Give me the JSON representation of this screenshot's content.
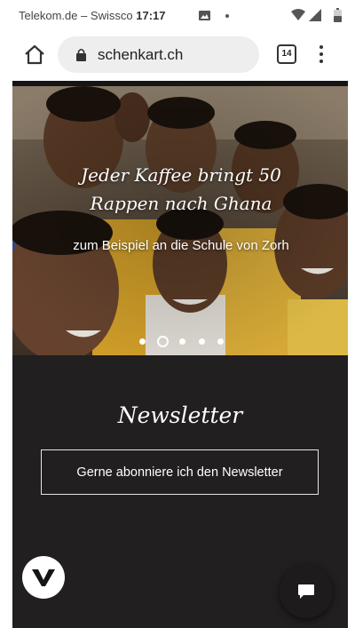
{
  "status_bar": {
    "carrier": "Telekom.de – Swissco",
    "time": "17:17"
  },
  "browser": {
    "url": "schenkart.ch",
    "tab_count": "14"
  },
  "hero": {
    "title": "Jeder Kaffee bringt 50 Rappen nach Ghana",
    "subtitle": "zum Beispiel an die Schule von Zorh",
    "slide_count": 5,
    "active_slide": 2
  },
  "newsletter": {
    "heading": "Newsletter",
    "button_label": "Gerne abonniere ich den Newsletter"
  },
  "icons": {
    "home": "home-icon",
    "lock": "lock-icon",
    "menu": "more-vert-icon",
    "brand": "v-logo-icon",
    "chat": "chat-icon"
  },
  "colors": {
    "page_bg": "#211f1f",
    "url_pill": "#eeeeee",
    "text_light": "#ffffff"
  }
}
